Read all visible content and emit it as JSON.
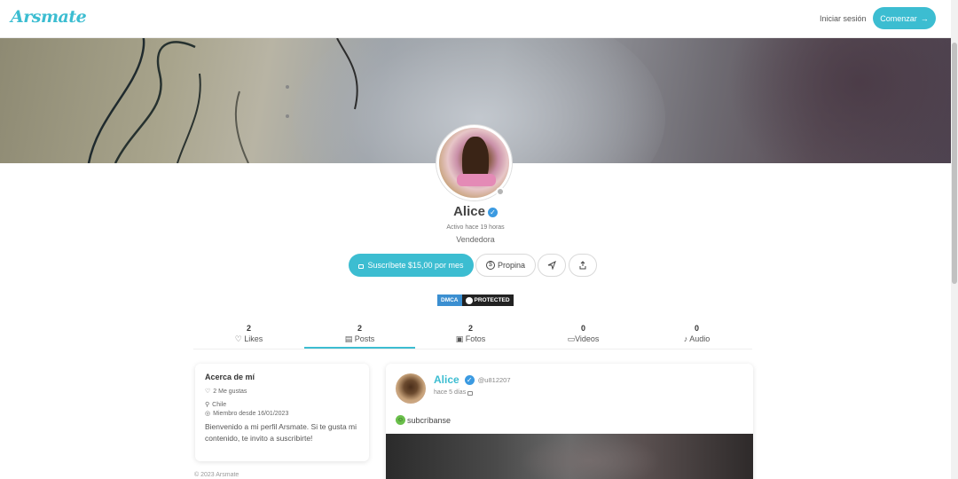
{
  "header": {
    "logo": "Arsmate",
    "login_label": "Iniciar sesión",
    "cta_label": "Comenzar",
    "cta_icon": "arrow-right-icon"
  },
  "profile": {
    "name": "Alice",
    "active_status": "Activo hace 19 horas",
    "role": "Vendedora"
  },
  "actions": {
    "subscribe_label": "Suscríbete $15,00 por mes",
    "tip_label": "Propina",
    "tip_icon": "coin-icon",
    "message_icon": "send-icon",
    "share_icon": "share-icon"
  },
  "dmca": {
    "left": "DMCA",
    "right": "PROTECTED"
  },
  "tabs": [
    {
      "count": "2",
      "label": "Likes",
      "icon": "heart-icon"
    },
    {
      "count": "2",
      "label": "Posts",
      "icon": "document-icon"
    },
    {
      "count": "2",
      "label": "Fotos",
      "icon": "image-icon"
    },
    {
      "count": "0",
      "label": "Videos",
      "icon": "video-icon"
    },
    {
      "count": "0",
      "label": "Audio",
      "icon": "microphone-icon"
    }
  ],
  "about": {
    "title": "Acerca de mí",
    "likes": "2 Me gustas",
    "location": "Chile",
    "member_since": "Miembro desde 16/01/2023",
    "bio": "Bienvenido a mi perfil Arsmate. Si te gusta mi contenido, te invito a suscribirte!"
  },
  "post": {
    "author": "Alice",
    "handle": "@u812207",
    "time": "hace 5 días",
    "text": "subcríbanse"
  },
  "footer": {
    "copyright": "© 2023 Arsmate"
  },
  "colors": {
    "accent": "#3cbdd1",
    "verified": "#3b9ae1"
  }
}
